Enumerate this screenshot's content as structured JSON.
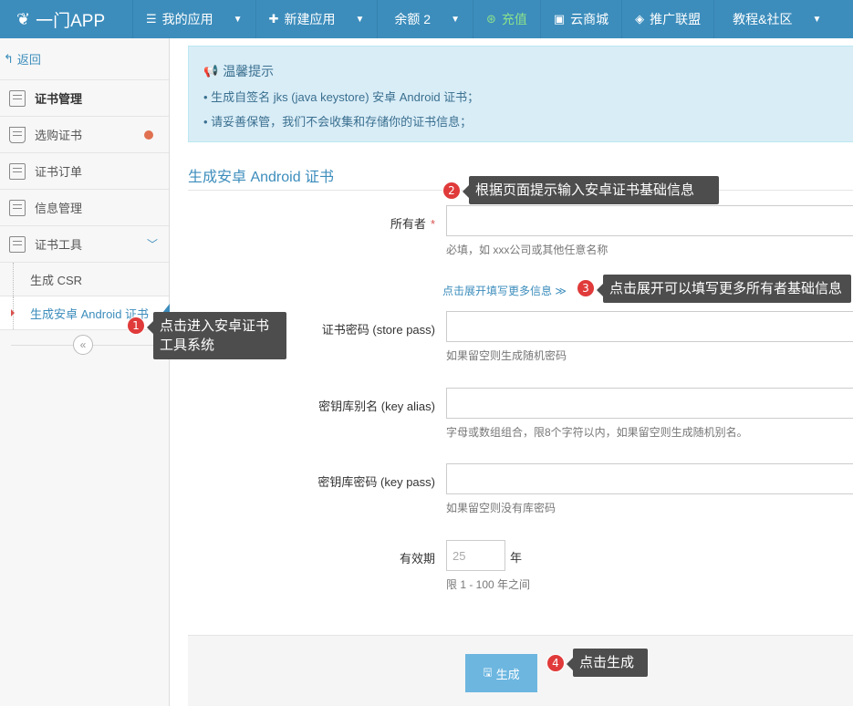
{
  "app": {
    "brand": "一门APP",
    "brand_icon": "leaf-icon"
  },
  "topnav": [
    {
      "label": "我的应用",
      "icon": "list-icon",
      "caret": true
    },
    {
      "label": "新建应用",
      "icon": "plus-icon",
      "caret": true
    },
    {
      "label": "余额 2",
      "icon": "",
      "caret": true
    },
    {
      "label": "充值",
      "icon": "charge-icon",
      "caret": false
    },
    {
      "label": "云商城",
      "icon": "store-icon",
      "caret": false
    },
    {
      "label": "推广联盟",
      "icon": "diamond-icon",
      "caret": false
    },
    {
      "label": "教程&社区",
      "icon": "",
      "caret": true
    }
  ],
  "sidebar": {
    "back": "返回",
    "items": [
      {
        "label": "证书管理"
      },
      {
        "label": "选购证书"
      },
      {
        "label": "证书订单"
      },
      {
        "label": "信息管理"
      },
      {
        "label": "证书工具"
      }
    ],
    "subitems": [
      {
        "label": "生成 CSR"
      },
      {
        "label": "生成安卓 Android 证书"
      }
    ]
  },
  "alert": {
    "title": "温馨提示",
    "lines": [
      "• 生成自签名 jks (java keystore) 安卓 Android 证书；",
      "• 请妥善保管，我们不会收集和存储你的证书信息；"
    ]
  },
  "form": {
    "title": "生成安卓 Android 证书",
    "owner_label": "所有者",
    "owner_required": "*",
    "owner_help": "必填，如 xxx公司或其他任意名称",
    "expand_link": "点击展开填写更多信息 ≫",
    "store_pass_label": "证书密码 (store pass)",
    "store_pass_help": "如果留空则生成随机密码",
    "key_alias_label": "密钥库别名 (key alias)",
    "key_alias_help": "字母或数组组合，限8个字符以内，如果留空则生成随机别名。",
    "key_pass_label": "密钥库密码 (key pass)",
    "key_pass_help": "如果留空则没有库密码",
    "validity_label": "有效期",
    "validity_value": "25",
    "validity_unit": "年",
    "validity_help": "限 1 - 100 年之间",
    "submit_label": "生成"
  },
  "callouts": [
    {
      "num": "1",
      "text": "点击进入安卓证书工具系统"
    },
    {
      "num": "2",
      "text": "根据页面提示输入安卓证书基础信息"
    },
    {
      "num": "3",
      "text": "点击展开可以填写更多所有者基础信息"
    },
    {
      "num": "4",
      "text": "点击生成"
    }
  ]
}
